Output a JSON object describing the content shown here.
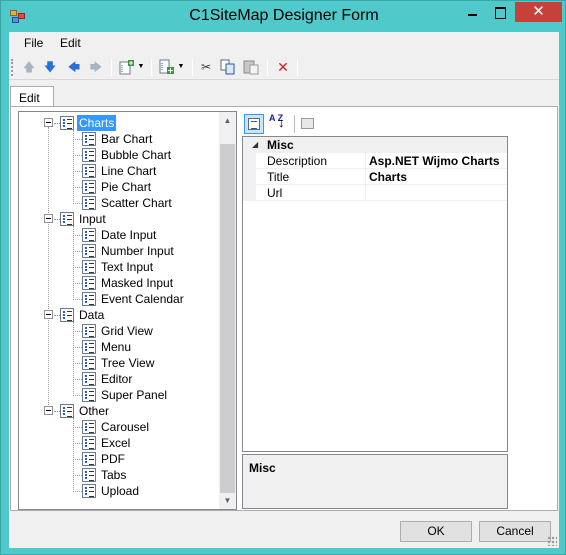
{
  "window": {
    "title": "C1SiteMap Designer Form",
    "close_glyph": "✕",
    "accent_color": "#4fc9c9",
    "close_color": "#c7403b"
  },
  "menu": [
    "File",
    "Edit"
  ],
  "toolbar": {
    "icons": [
      "move-up-icon",
      "move-down-icon",
      "move-left-icon",
      "move-right-icon",
      "add-child-icon",
      "insert-icon",
      "cut-icon",
      "copy-icon",
      "paste-icon",
      "delete-icon"
    ],
    "glyphs": {
      "up": "🡅",
      "down": "🡇",
      "left": "🡄",
      "right": "🡆",
      "cut": "✂",
      "delete": "✕"
    }
  },
  "tab": {
    "label": "Edit"
  },
  "tree": {
    "nodes": [
      {
        "label": "Charts",
        "selected": true,
        "children": [
          "Bar Chart",
          "Bubble Chart",
          "Line Chart",
          "Pie Chart",
          "Scatter Chart"
        ]
      },
      {
        "label": "Input",
        "children": [
          "Date Input",
          "Number Input",
          "Text Input",
          "Masked Input",
          "Event Calendar"
        ]
      },
      {
        "label": "Data",
        "children": [
          "Grid View",
          "Menu",
          "Tree View",
          "Editor",
          "Super Panel"
        ]
      },
      {
        "label": "Other",
        "children": [
          "Carousel",
          "Excel",
          "PDF",
          "Tabs",
          "Upload"
        ]
      }
    ]
  },
  "property_grid": {
    "category": "Misc",
    "rows": [
      {
        "name": "Description",
        "value": "Asp.NET Wijmo Charts"
      },
      {
        "name": "Title",
        "value": "Charts"
      },
      {
        "name": "Url",
        "value": ""
      }
    ],
    "help_title": "Misc",
    "az_label": "A Z"
  },
  "buttons": {
    "ok": "OK",
    "cancel": "Cancel"
  }
}
